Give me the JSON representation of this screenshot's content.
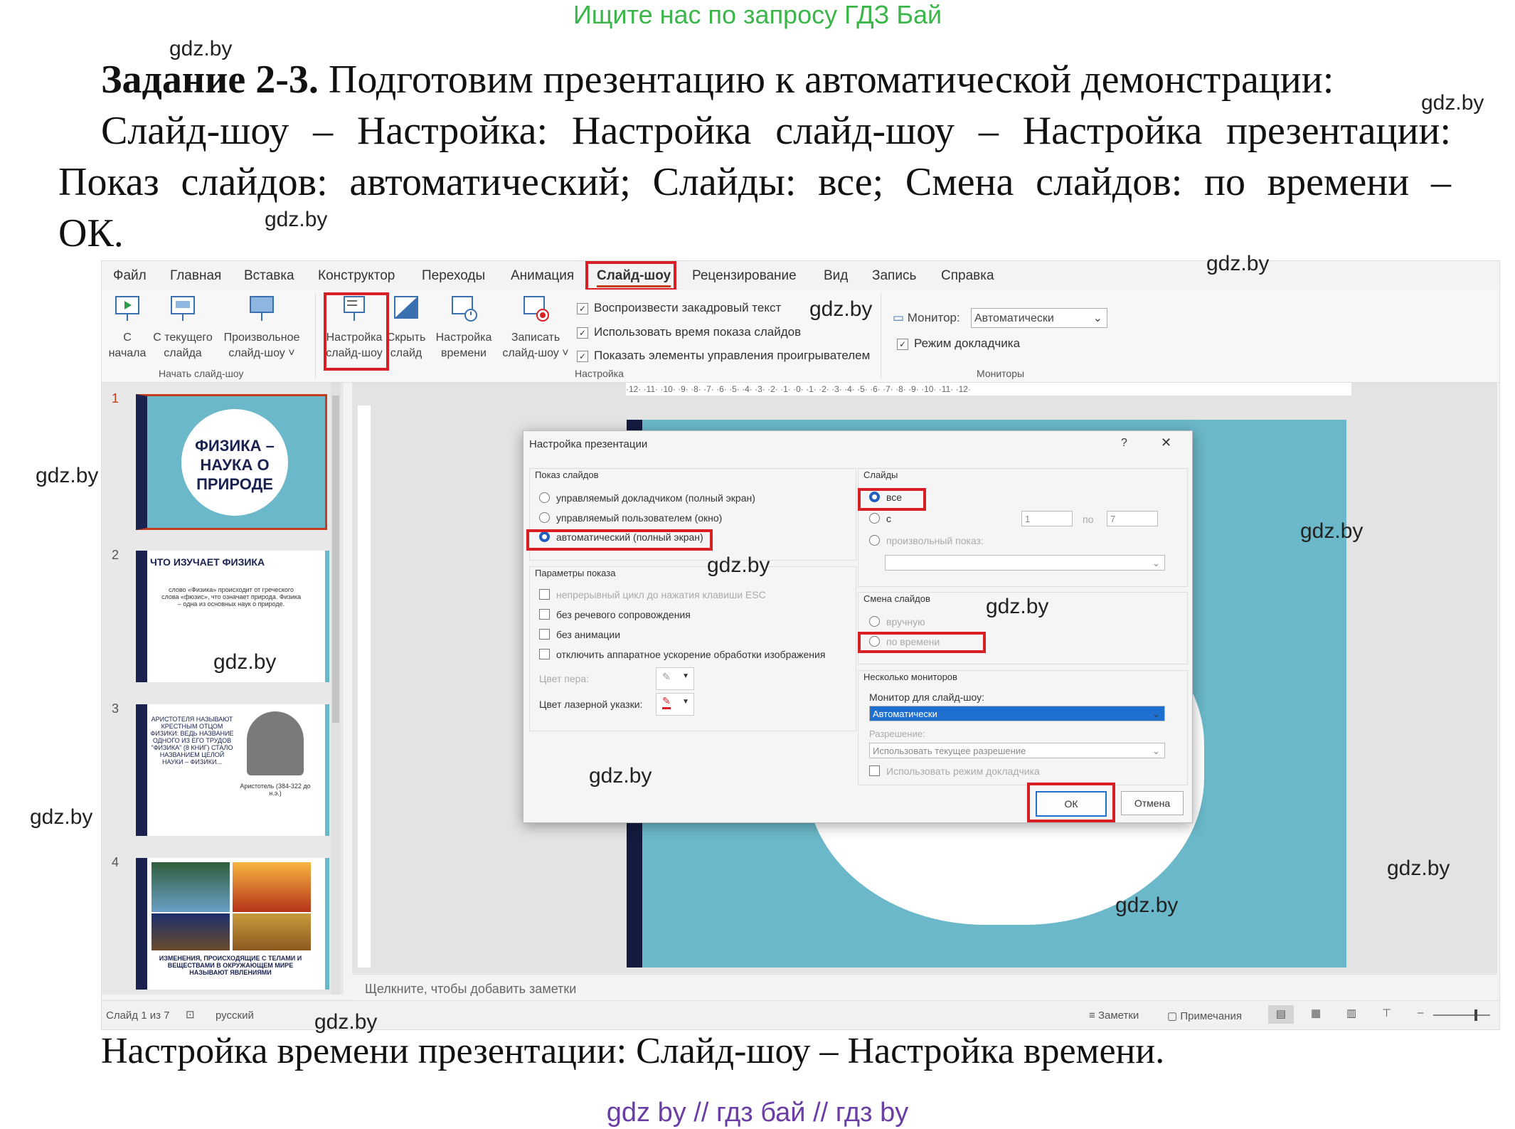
{
  "header_ad": "Ищите нас по запросу ГДЗ Бай",
  "task": {
    "bold": "Задание 2-3.",
    "line1": "Подготовим презентацию к автоматической демонстрации:",
    "line2": "Слайд-шоу – Настройка: Настройка слайд-шоу – Настройка презентации:",
    "line3": "Показ слайдов: автоматический; Слайды: все; Смена слайдов: по времени –",
    "line4": "ОК."
  },
  "watermark": "gdz.by",
  "menu": [
    "Файл",
    "Главная",
    "Вставка",
    "Конструктор",
    "Переходы",
    "Анимация",
    "Слайд-шоу",
    "Рецензирование",
    "Вид",
    "Запись",
    "Справка"
  ],
  "ribbon": {
    "btn_from_start": [
      "С",
      "начала"
    ],
    "btn_from_current": [
      "С текущего",
      "слайда"
    ],
    "btn_custom": [
      "Произвольное",
      "слайд-шоу ˅"
    ],
    "group_start": "Начать слайд-шоу",
    "btn_setup": [
      "Настройка",
      "слайд-шоу"
    ],
    "btn_hide": [
      "Скрыть",
      "слайд"
    ],
    "btn_timing": [
      "Настройка",
      "времени"
    ],
    "btn_record": [
      "Записать",
      "слайд-шоу ˅"
    ],
    "chk_narration": "Воспроизвести закадровый текст",
    "chk_timings": "Использовать время показа слайдов",
    "chk_media": "Показать элементы управления проигрывателем",
    "group_setup": "Настройка",
    "monitor_label": "Монитор:",
    "monitor_value": "Автоматически",
    "chk_presenter": "Режим докладчика",
    "group_monitors": "Мониторы"
  },
  "ruler": "·12· ·11· ·10· ·9· ·8· ·7· ·6· ·5· ·4· ·3· ·2· ·1· ·0· ·1· ·2· ·3· ·4· ·5· ·6· ·7· ·8· ·9· ·10· ·11· ·12·",
  "thumbs": {
    "n1": "1",
    "t1a": "ФИЗИКА –",
    "t1b": "НАУКА О",
    "t1c": "ПРИРОДЕ",
    "n2": "2",
    "t2": "ЧТО ИЗУЧАЕТ ФИЗИКА",
    "t2body": "слово «Физика» происходит от греческого слова «фюзис», что означает природа. Физика – одна из основных наук о природе.",
    "n3": "3",
    "t3": "АРИСТОТЕЛЯ НАЗЫВАЮТ КРЕСТНЫМ ОТЦОМ ФИЗИКИ: ВЕДЬ НАЗВАНИЕ ОДНОГО ИЗ ЕГО ТРУДОВ \"ФИЗИКА\" (8 КНИГ) СТАЛО НАЗВАНИЕМ ЦЕЛОЙ НАУКИ – ФИЗИКИ...",
    "t3cap": "Аристотель (384-322 до н.э.)",
    "n4": "4",
    "t4": "ИЗМЕНЕНИЯ, ПРОИСХОДЯЩИЕ С ТЕЛАМИ И ВЕЩЕСТВАМИ В ОКРУЖАЮЩЕМ МИРЕ НАЗЫВАЮТ ЯВЛЕНИЯМИ"
  },
  "dialog": {
    "title": "Настройка презентации",
    "help": "?",
    "close": "✕",
    "show_type": "Показ слайдов",
    "r_presenter": "управляемый докладчиком (полный экран)",
    "r_individual": "управляемый пользователем (окно)",
    "r_kiosk": "автоматический (полный экран)",
    "show_options": "Параметры показа",
    "c_loop": "непрерывный цикл до нажатия клавиши ESC",
    "c_nonarr": "без речевого сопровождения",
    "c_noanim": "без анимации",
    "c_nohw": "отключить аппаратное ускорение обработки изображения",
    "pen": "Цвет пера:",
    "laser": "Цвет лазерной указки:",
    "slides": "Слайды",
    "r_all": "все",
    "r_from": "с",
    "from_val": "1",
    "to_label": "по",
    "to_val": "7",
    "r_custom": "произвольный показ:",
    "advance": "Смена слайдов",
    "r_manual": "вручную",
    "r_timings": "по времени",
    "multi": "Несколько мониторов",
    "monitor_for": "Монитор для слайд-шоу:",
    "monitor_val": "Автоматически",
    "resolution": "Разрешение:",
    "resolution_val": "Использовать текущее разрешение",
    "c_presenter": "Использовать режим докладчика",
    "ok": "ОК",
    "cancel": "Отмена"
  },
  "notes_placeholder": "Щелкните, чтобы добавить заметки",
  "status": {
    "slide": "Слайд 1 из 7",
    "lang": "русский",
    "notes": "Заметки",
    "comments": "Примечания"
  },
  "bottom_line": "Настройка времени презентации: Слайд-шоу – Настройка времени.",
  "footer": "gdz by  //  гдз бай  //  гдз by",
  "colors": {
    "accent_red": "#d81f26",
    "slide_teal": "#6ab8c9",
    "slide_navy": "#131c3f",
    "header_green": "#3cb64a",
    "footer_purple": "#6b3ea6"
  }
}
